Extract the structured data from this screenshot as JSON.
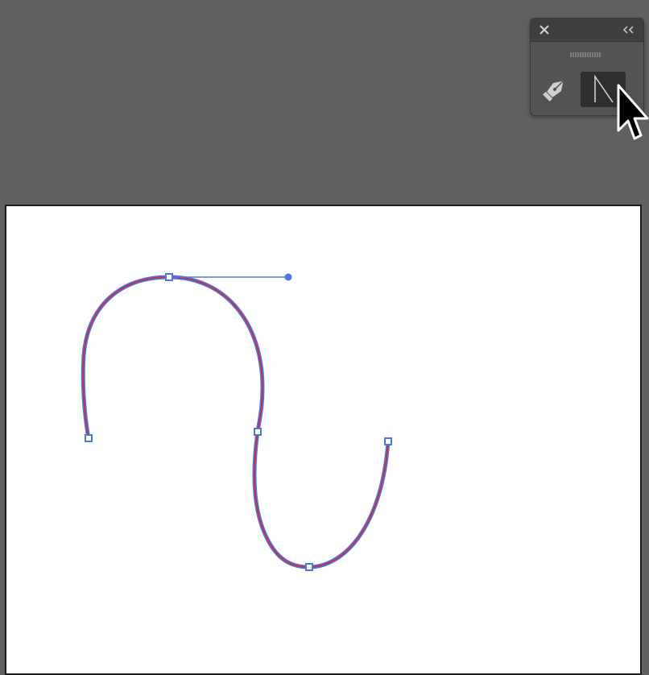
{
  "app": {
    "workspace_color": "#606060",
    "artboard_color": "#ffffff"
  },
  "panel": {
    "close_icon": "close-icon",
    "collapse_icon": "double-chevron-left-icon",
    "grip_icon": "drag-grip-icon",
    "tools": [
      {
        "name": "pen-tool",
        "icon": "pen-icon",
        "selected": false
      },
      {
        "name": "curvature-anchor-tool",
        "icon": "anchor-point-icon",
        "selected": true
      }
    ]
  },
  "path": {
    "stroke_color": "#c8323c",
    "selection_color": "#4a78e8",
    "anchor_count": 5,
    "handle_count": 1
  }
}
